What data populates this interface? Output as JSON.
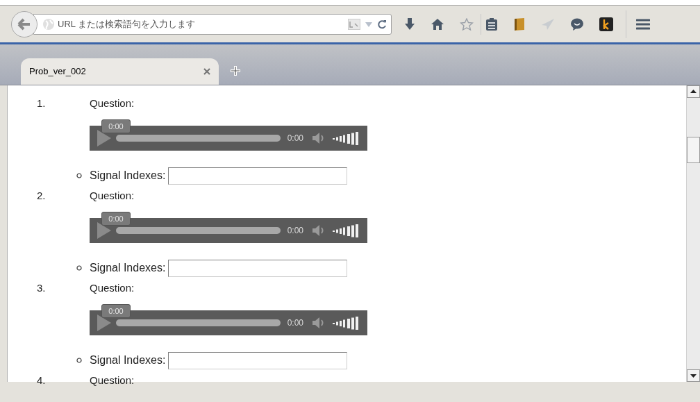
{
  "toolbar": {
    "url_placeholder": "URL または検索語句を入力します"
  },
  "tabs": [
    {
      "title": "Prob_ver_002",
      "selected": true
    }
  ],
  "questions": [
    {
      "number": "1.",
      "label": "Question:",
      "player": {
        "tooltip": "0:00",
        "time": "0:00",
        "level": 0
      },
      "field_label": "Signal Indexes:"
    },
    {
      "number": "2.",
      "label": "Question:",
      "player": {
        "tooltip": "0:00",
        "time": "0:00",
        "level": 0
      },
      "field_label": "Signal Indexes:"
    },
    {
      "number": "3.",
      "label": "Question:",
      "player": {
        "tooltip": "0:00",
        "time": "0:00",
        "level": 0
      },
      "field_label": "Signal Indexes:"
    },
    {
      "number": "4.",
      "label": "Question:"
    }
  ]
}
